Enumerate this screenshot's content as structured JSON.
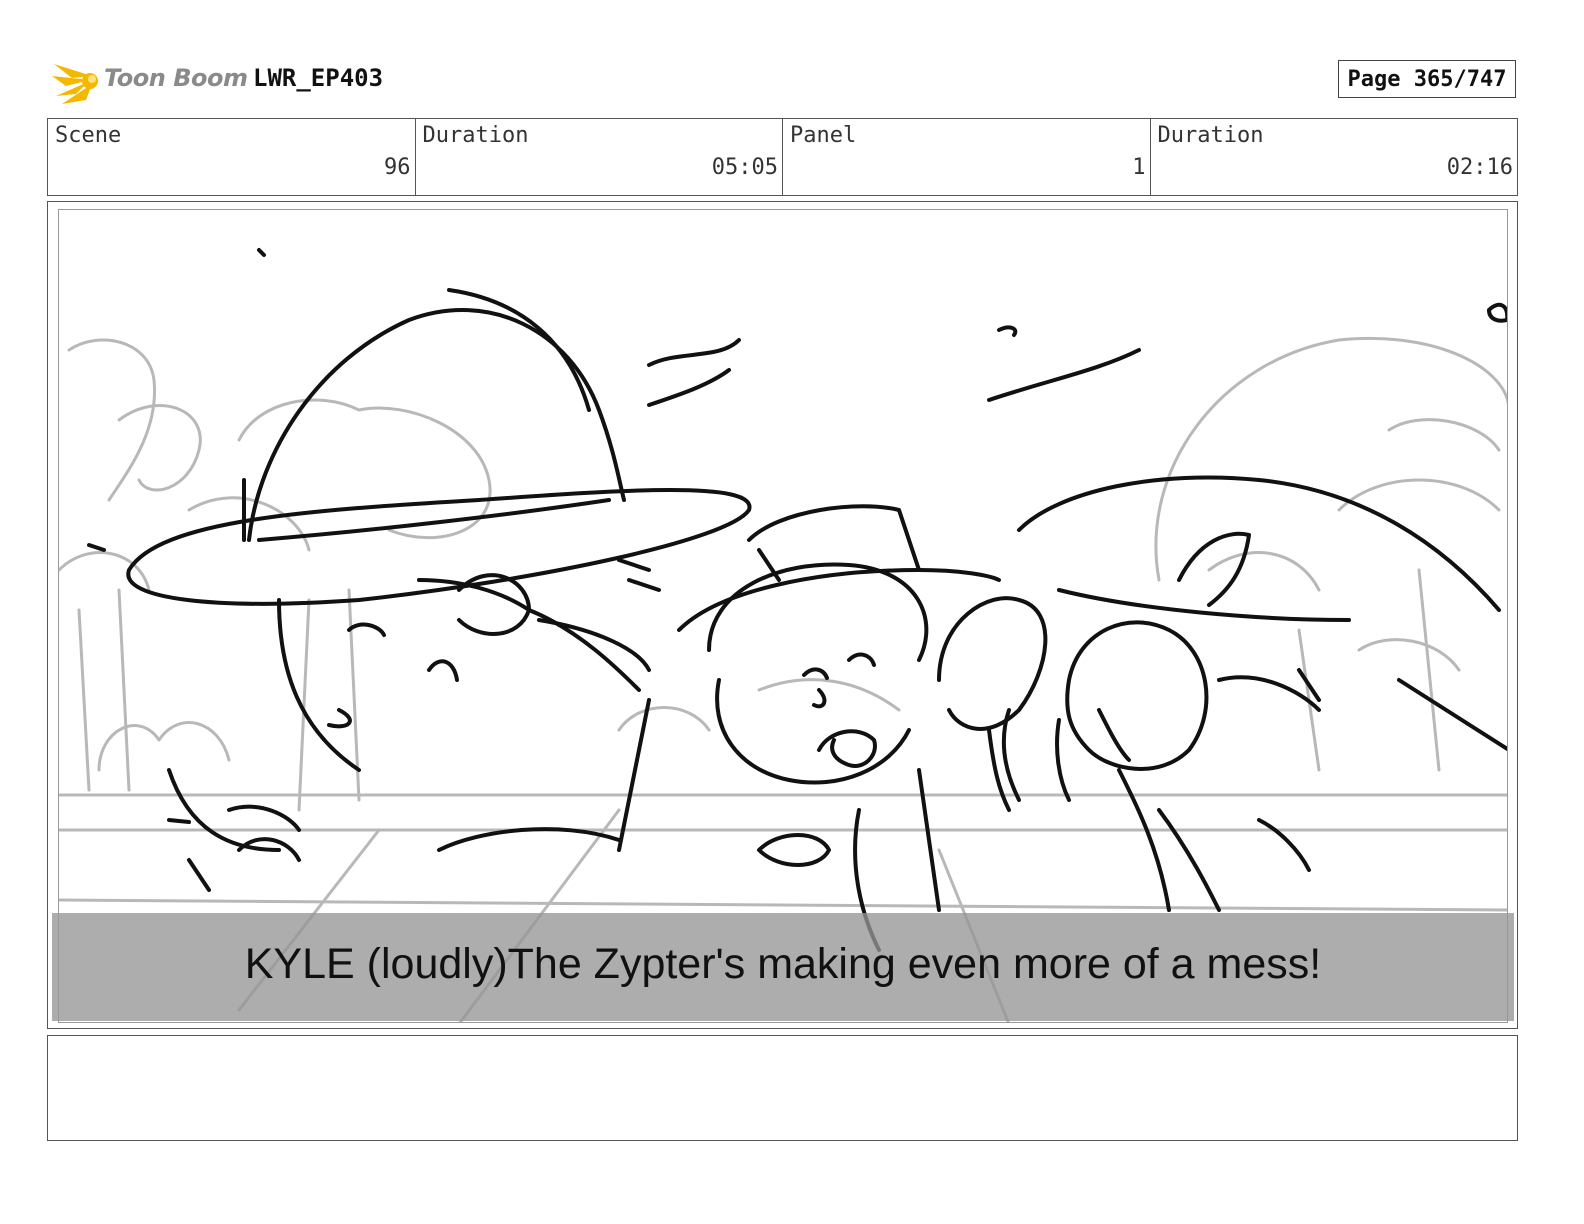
{
  "header": {
    "logo_text": "Toon Boom",
    "project": "LWR_EP403",
    "page": "Page 365/747"
  },
  "info": [
    {
      "label": "Scene",
      "value": "96"
    },
    {
      "label": "Duration",
      "value": "05:05"
    },
    {
      "label": "Panel",
      "value": "1"
    },
    {
      "label": "Duration",
      "value": "02:16"
    }
  ],
  "panel": {
    "caption": "KYLE (loudly)The Zypter's making even more of a mess!",
    "notes": ""
  },
  "colors": {
    "logo_star": "#f5b800",
    "logo_text": "#8a8a8a",
    "caption_band": "#969696"
  }
}
